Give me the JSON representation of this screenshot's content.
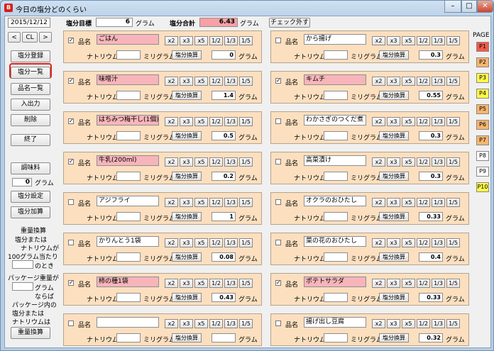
{
  "window": {
    "title": "今日の塩分どのくらい",
    "app_icon": "B"
  },
  "header": {
    "date": "2015/12/12",
    "prev_label": "<",
    "cl_label": "CL",
    "next_label": ">",
    "target_label": "塩分目標",
    "target_value": "6",
    "target_unit": "グラム",
    "total_label": "塩分合計",
    "total_value": "6.43",
    "total_unit": "グラム",
    "uncheck_label": "チェック外す"
  },
  "sidebar": {
    "register": "塩分登録",
    "list": "塩分一覧",
    "item_list": "品名一覧",
    "io": "入出力",
    "delete": "削除",
    "exit": "終了",
    "seasoning": "調味料",
    "seasoning_value": "0",
    "seasoning_unit": "グラム",
    "salt_setting": "塩分設定",
    "salt_add": "塩分加算",
    "weight_conv_title": "重量換算",
    "conv_line1": "塩分または",
    "conv_line2": "ナトリウムが",
    "conv_line3": "100グラム当たり",
    "conv_line4": "のとき",
    "pkg_line1": "パッケージ重量が",
    "pkg_line2": "グラム",
    "pkg_line3": "ならば",
    "pkg_line4": "パッケージ内の",
    "pkg_line5": "塩分または",
    "pkg_line6": "ナトリウムは",
    "weight_conv_button": "重量換算"
  },
  "labels": {
    "item": "品名",
    "sodium": "ナトリウム",
    "mg": "ミリグラム",
    "calc": "塩分換算",
    "gram": "グラム",
    "m2": "x2",
    "m3": "x3",
    "m5": "x5",
    "d2": "1/2",
    "d3": "1/3",
    "d5": "1/5"
  },
  "left_items": [
    {
      "name": "ごはん",
      "checked": true,
      "value": "0",
      "pink": true
    },
    {
      "name": "味噌汁",
      "checked": true,
      "value": "1.4",
      "pink": true
    },
    {
      "name": "はちみつ梅干し(1個)",
      "checked": true,
      "value": "0.5",
      "pink": true
    },
    {
      "name": "牛乳(200ml)",
      "checked": true,
      "value": "0.2",
      "pink": true
    },
    {
      "name": "アジフライ",
      "checked": false,
      "value": "1",
      "pink": false
    },
    {
      "name": "かりんとう1袋",
      "checked": false,
      "value": "0.08",
      "pink": false
    },
    {
      "name": "柿の種1袋",
      "checked": true,
      "value": "0.43",
      "pink": true
    },
    {
      "name": "",
      "checked": false,
      "value": "",
      "pink": false
    }
  ],
  "right_items": [
    {
      "name": "から揚げ",
      "checked": false,
      "value": "0.3",
      "pink": false
    },
    {
      "name": "キムチ",
      "checked": true,
      "value": "0.55",
      "pink": true
    },
    {
      "name": "わかさぎのつくだ煮",
      "checked": false,
      "value": "0.3",
      "pink": false
    },
    {
      "name": "高菜漬け",
      "checked": false,
      "value": "0.3",
      "pink": false
    },
    {
      "name": "オクラのおひたし",
      "checked": false,
      "value": "0.33",
      "pink": false
    },
    {
      "name": "菜の花のおひたし",
      "checked": false,
      "value": "0.4",
      "pink": false
    },
    {
      "name": "ポテトサラダ",
      "checked": true,
      "value": "0.33",
      "pink": true
    },
    {
      "name": "揚げ出し豆腐",
      "checked": false,
      "value": "0.32",
      "pink": false
    }
  ],
  "pages": {
    "label": "PAGE",
    "items": [
      {
        "label": "P1",
        "color": "#f45a4a"
      },
      {
        "label": "P2",
        "color": "#f6b66e"
      },
      {
        "label": "P3",
        "color": "#fff84a"
      },
      {
        "label": "P4",
        "color": "#fff84a"
      },
      {
        "label": "P5",
        "color": "#f6b66e"
      },
      {
        "label": "P6",
        "color": "#f6b66e"
      },
      {
        "label": "P7",
        "color": "#f6b66e"
      },
      {
        "label": "P8",
        "color": "#ffffff"
      },
      {
        "label": "P9",
        "color": "#ffffff"
      },
      {
        "label": "P10",
        "color": "#fff84a"
      }
    ]
  }
}
